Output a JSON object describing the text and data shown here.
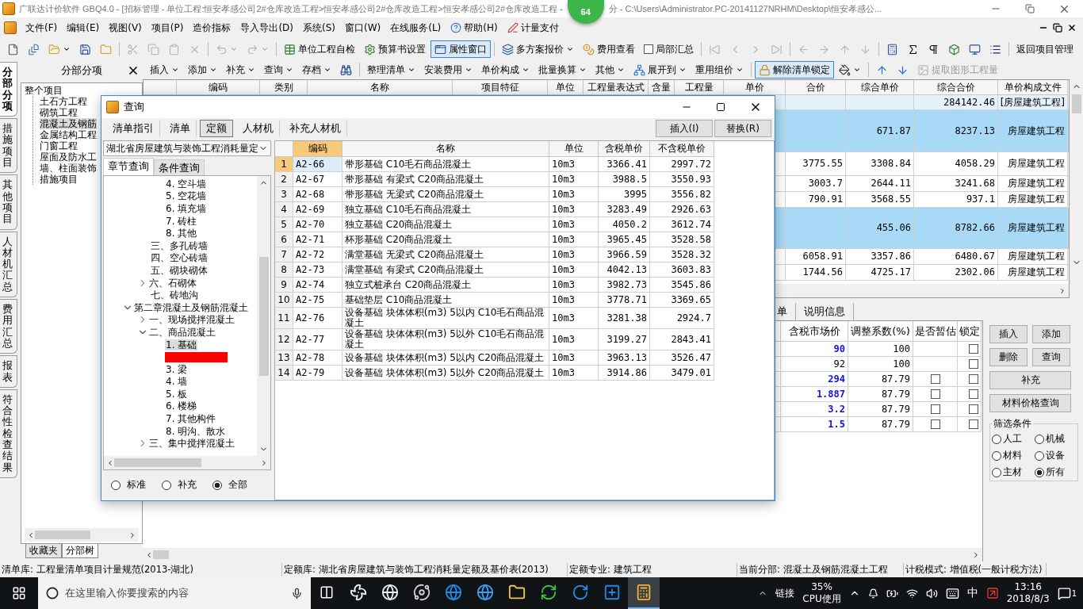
{
  "title": {
    "text_left": "广联达计价软件 GBQ4.0 - [招标管理 - 单位工程:恒安孝感公司2#仓库改造工程>恒安孝感公司2#仓库改造工程>恒安孝感公司2#仓库改造工程 -",
    "badge": "64",
    "text_right": "分 - C:\\Users\\Administrator.PC-20141127NRHM\\Desktop\\恒安孝感公..."
  },
  "menu": [
    "文件(F)",
    "编辑(E)",
    "视图(V)",
    "项目(P)",
    "造价指标",
    "导入导出(D)",
    "系统(S)",
    "窗口(W)",
    "在线服务(L)",
    "帮助(H)",
    "计量支付"
  ],
  "toolbar": [
    {
      "kind": "icon",
      "disabled": false
    },
    {
      "kind": "icon",
      "disabled": false
    },
    {
      "kind": "icon",
      "disabled": false,
      "dropdown": true
    },
    {
      "kind": "icon",
      "disabled": false
    },
    {
      "kind": "icon",
      "disabled": false
    },
    {
      "kind": "sep"
    },
    {
      "kind": "icon",
      "disabled": true
    },
    {
      "kind": "icon",
      "disabled": true
    },
    {
      "kind": "icon",
      "disabled": true
    },
    {
      "kind": "icon",
      "disabled": true
    },
    {
      "kind": "sep"
    },
    {
      "kind": "icon",
      "disabled": true,
      "dropdown": true
    },
    {
      "kind": "icon",
      "disabled": true,
      "dropdown": true
    },
    {
      "kind": "sep"
    },
    {
      "kind": "button",
      "label": "单位工程自检",
      "pressed": false
    },
    {
      "kind": "button",
      "label": "预算书设置",
      "pressed": false
    },
    {
      "kind": "button",
      "label": "属性窗口",
      "pressed": true
    },
    {
      "kind": "sep"
    },
    {
      "kind": "button",
      "label": "多方案报价",
      "pressed": false,
      "dropdown": true
    },
    {
      "kind": "button",
      "label": "费用查看",
      "pressed": false
    },
    {
      "kind": "check",
      "label": "局部汇总",
      "checked": false
    },
    {
      "kind": "sep"
    },
    {
      "kind": "icon",
      "disabled": true
    },
    {
      "kind": "icon",
      "disabled": true
    },
    {
      "kind": "icon",
      "disabled": true
    },
    {
      "kind": "icon",
      "disabled": true
    },
    {
      "kind": "sep"
    },
    {
      "kind": "icon",
      "disabled": true
    },
    {
      "kind": "icon",
      "disabled": true
    },
    {
      "kind": "icon",
      "disabled": true
    },
    {
      "kind": "icon",
      "disabled": true
    },
    {
      "kind": "sep"
    },
    {
      "kind": "icon",
      "disabled": false
    },
    {
      "kind": "icon",
      "disabled": false
    },
    {
      "kind": "icon",
      "disabled": false
    },
    {
      "kind": "icon",
      "disabled": false
    },
    {
      "kind": "icon",
      "disabled": false
    },
    {
      "kind": "icon",
      "disabled": false
    },
    {
      "kind": "sep"
    },
    {
      "kind": "button",
      "label": "返回项目管理",
      "pressed": false
    }
  ],
  "side_tabs": [
    {
      "label": "分部分项",
      "selected": true
    },
    {
      "label": "措施项目",
      "selected": false
    },
    {
      "label": "其他项目",
      "selected": false
    },
    {
      "label": "人材机汇总",
      "selected": false
    },
    {
      "label": "费用汇总",
      "selected": false
    },
    {
      "label": "报表",
      "selected": false
    },
    {
      "label": "符合性检查结果",
      "selected": false
    }
  ],
  "section_panel": {
    "title": "分部分项",
    "tree": {
      "label": "整个项目",
      "children": [
        {
          "label": "土石方工程",
          "selected": false
        },
        {
          "label": "砌筑工程",
          "selected": false
        },
        {
          "label": "混凝土及钢筋",
          "selected": true
        },
        {
          "label": "金属结构工程",
          "selected": false
        },
        {
          "label": "门窗工程",
          "selected": false
        },
        {
          "label": "屋面及防水工",
          "selected": false
        },
        {
          "label": "墙、柱面装饰",
          "selected": false
        },
        {
          "label": "措施项目",
          "selected": false
        }
      ]
    },
    "bottom_tabs": [
      {
        "label": "收藏夹",
        "selected": false
      },
      {
        "label": "分部树",
        "selected": true
      }
    ]
  },
  "edit_toolbar": [
    {
      "kind": "button",
      "label": "插入",
      "dropdown": true
    },
    {
      "kind": "button",
      "label": "添加",
      "dropdown": true
    },
    {
      "kind": "button",
      "label": "补充",
      "dropdown": true
    },
    {
      "kind": "button",
      "label": "查询",
      "dropdown": true
    },
    {
      "kind": "button",
      "label": "存档",
      "dropdown": true
    },
    {
      "kind": "icon"
    },
    {
      "kind": "sep"
    },
    {
      "kind": "button",
      "label": "整理清单",
      "dropdown": true
    },
    {
      "kind": "button",
      "label": "安装费用",
      "dropdown": true
    },
    {
      "kind": "button",
      "label": "单价构成",
      "dropdown": true
    },
    {
      "kind": "button",
      "label": "批量换算",
      "dropdown": true
    },
    {
      "kind": "button",
      "label": "其他",
      "dropdown": true
    },
    {
      "kind": "button",
      "label": "展开到",
      "dropdown": true
    },
    {
      "kind": "button",
      "label": "重用组价",
      "dropdown": true
    },
    {
      "kind": "sep"
    },
    {
      "kind": "button",
      "label": "解除清单锁定",
      "pressed": true
    },
    {
      "kind": "icon",
      "dropdown": true
    },
    {
      "kind": "sep"
    },
    {
      "kind": "icon"
    },
    {
      "kind": "icon"
    },
    {
      "kind": "button",
      "label": "提取图形工程量",
      "disabled": true
    }
  ],
  "main_table": {
    "columns": [
      "编码",
      "类别",
      "名称",
      "项目特征",
      "单位",
      "工程量表达式",
      "含量",
      "工程量",
      "单价",
      "合价",
      "综合单价",
      "综合合价",
      "单价构成文件"
    ],
    "rows": [
      {
        "kind": "project",
        "composite_total": "284142.46",
        "pricing_file": "[房屋建筑工程]"
      },
      {
        "kind": "section",
        "composite_unit_price": "671.87",
        "composite_total": "8237.13",
        "pricing_file": "房屋建筑工程"
      },
      {
        "kind": "item",
        "total_price": "3775.55",
        "composite_unit_price": "3308.84",
        "composite_total": "4058.29",
        "pricing_file": "房屋建筑工程"
      },
      {
        "kind": "item",
        "total_price": "3003.7",
        "composite_unit_price": "2644.11",
        "composite_total": "3241.68",
        "pricing_file": "房屋建筑工程"
      },
      {
        "kind": "item",
        "total_price": "790.91",
        "composite_unit_price": "3568.55",
        "composite_total": "937.1",
        "pricing_file": "房屋建筑工程"
      },
      {
        "kind": "section",
        "composite_unit_price": "455.06",
        "composite_total": "8782.66",
        "pricing_file": "房屋建筑工程"
      },
      {
        "kind": "item",
        "total_price": "6058.91",
        "composite_unit_price": "3357.86",
        "composite_total": "6480.67",
        "pricing_file": "房屋建筑工程"
      },
      {
        "kind": "item",
        "total_price": "1744.56",
        "composite_unit_price": "4725.17",
        "composite_total": "2302.06",
        "pricing_file": "房屋建筑工程"
      }
    ]
  },
  "detail_tabs": [
    "单",
    "说明信息"
  ],
  "detail_table": {
    "columns": [
      "含税市场价",
      "调整系数(%)",
      "是否暂估",
      "锁定"
    ],
    "rows": [
      {
        "market_price": "90",
        "modified": true,
        "factor": "100",
        "locked": false
      },
      {
        "market_price": "92",
        "modified": false,
        "factor": "100",
        "locked": false
      },
      {
        "market_price": "294",
        "modified": true,
        "factor": "87.79",
        "estimated": false,
        "locked": false
      },
      {
        "market_price": "1.887",
        "modified": true,
        "factor": "87.79",
        "estimated": false,
        "locked": false
      },
      {
        "market_price": "3.2",
        "modified": true,
        "factor": "87.79",
        "estimated": false,
        "locked": false
      },
      {
        "market_price": "1.5",
        "modified": true,
        "factor": "87.79",
        "estimated": false,
        "locked": false
      }
    ]
  },
  "side_buttons": [
    "插入",
    "添加",
    "删除",
    "查询",
    "补充",
    "材料价格查询"
  ],
  "filter": {
    "title": "筛选条件",
    "options": [
      {
        "label": "人工",
        "selected": false
      },
      {
        "label": "机械",
        "selected": false
      },
      {
        "label": "材料",
        "selected": false
      },
      {
        "label": "设备",
        "selected": false
      },
      {
        "label": "主材",
        "selected": false
      },
      {
        "label": "所有",
        "selected": true
      }
    ]
  },
  "dialog": {
    "title": "查询",
    "tabs": [
      {
        "label": "清单指引",
        "selected": false
      },
      {
        "label": "清单",
        "selected": false
      },
      {
        "label": "定额",
        "selected": true
      },
      {
        "label": "人材机",
        "selected": false
      },
      {
        "label": "补充人材机",
        "selected": false
      }
    ],
    "buttons": [
      "插入(I)",
      "替换(R)"
    ],
    "library": "湖北省房屋建筑与装饰工程消耗量定",
    "sub_tabs": [
      {
        "label": "章节查询",
        "selected": true
      },
      {
        "label": "条件查询",
        "selected": false
      }
    ],
    "tree": [
      {
        "children": [
          {
            "children": [
              {
                "children": [
                  {
                    "label": "4. 空斗墙"
                  },
                  {
                    "label": "5. 空花墙"
                  },
                  {
                    "label": "6. 填充墙"
                  },
                  {
                    "label": "7. 砖柱"
                  },
                  {
                    "label": "8. 其他"
                  }
                ]
              },
              {
                "label": "三、多孔砖墙"
              },
              {
                "label": "四、空心砖墙"
              },
              {
                "label": "五、砌块砌体"
              },
              {
                "label": "六、石砌体",
                "expanded": false
              },
              {
                "label": "七、砖地沟"
              }
            ]
          },
          {
            "label": "第二章混凝土及钢筋混凝土",
            "expanded": true,
            "children": [
              {
                "label": "一、现场搅拌混凝土",
                "expanded": false
              },
              {
                "label": "二、商品混凝土",
                "expanded": true,
                "children": [
                  {
                    "label": "1. 基础",
                    "selected": true
                  },
                  {
                    "kind": "redacted"
                  },
                  {
                    "label": "3. 梁"
                  },
                  {
                    "label": "4. 墙"
                  },
                  {
                    "label": "5. 板"
                  },
                  {
                    "label": "6. 楼梯"
                  },
                  {
                    "label": "7. 其他构件"
                  },
                  {
                    "label": "8. 明沟、散水"
                  }
                ]
              },
              {
                "label": "三、集中搅拌混凝土",
                "expanded": false
              }
            ]
          }
        ]
      }
    ],
    "scope": [
      {
        "label": "标准",
        "selected": false
      },
      {
        "label": "补充",
        "selected": false
      },
      {
        "label": "全部",
        "selected": true
      }
    ],
    "table": {
      "columns": [
        "编码",
        "名称",
        "单位",
        "含税单价",
        "不含税单价"
      ],
      "rows": [
        {
          "no": "1",
          "code": "A2-66",
          "name": "带形基础 C10毛石商品混凝土",
          "unit": "10m3",
          "price_tax": "3366.41",
          "price_net": "2997.72",
          "selected": true,
          "underlined": false
        },
        {
          "no": "2",
          "code": "A2-67",
          "name": "带形基础 有梁式 C20商品混凝土",
          "unit": "10m3",
          "price_tax": "3988.5",
          "price_net": "3550.93",
          "selected": false,
          "underlined": false
        },
        {
          "no": "3",
          "code": "A2-68",
          "name": "带形基础 无梁式 C20商品混凝土",
          "unit": "10m3",
          "price_tax": "3995",
          "price_net": "3556.82",
          "selected": false,
          "underlined": false
        },
        {
          "no": "4",
          "code": "A2-69",
          "name": "独立基础 C10毛石商品混凝土",
          "unit": "10m3",
          "price_tax": "3283.49",
          "price_net": "2926.63",
          "selected": false,
          "underlined": false
        },
        {
          "no": "5",
          "code": "A2-70",
          "name": "独立基础 C20商品混凝土",
          "unit": "10m3",
          "price_tax": "4050.2",
          "price_net": "3612.74",
          "selected": false,
          "underlined": false
        },
        {
          "no": "6",
          "code": "A2-71",
          "name": "杯形基础 C20商品混凝土",
          "unit": "10m3",
          "price_tax": "3965.45",
          "price_net": "3528.58",
          "selected": false,
          "underlined": false
        },
        {
          "no": "7",
          "code": "A2-72",
          "name": "满堂基础 无梁式 C20商品混凝土",
          "unit": "10m3",
          "price_tax": "3966.59",
          "price_net": "3528.32",
          "selected": false,
          "underlined": false
        },
        {
          "no": "8",
          "code": "A2-73",
          "name": "满堂基础 有梁式 C20商品混凝土",
          "unit": "10m3",
          "price_tax": "4042.13",
          "price_net": "3603.83",
          "selected": false,
          "underlined": true
        },
        {
          "no": "9",
          "code": "A2-74",
          "name": "独立式桩承台 C20商品混凝土",
          "unit": "10m3",
          "price_tax": "3982.73",
          "price_net": "3545.86",
          "selected": false,
          "underlined": false
        },
        {
          "no": "10",
          "code": "A2-75",
          "name": "基础垫层 C10商品混凝土",
          "unit": "10m3",
          "price_tax": "3778.71",
          "price_net": "3369.65",
          "selected": false,
          "underlined": false
        },
        {
          "no": "11",
          "code": "A2-76",
          "name": "设备基础 块体体积(m3) 5以内 C10毛石商品混凝土",
          "unit": "10m3",
          "price_tax": "3281.38",
          "price_net": "2924.7",
          "selected": false,
          "underlined": false
        },
        {
          "no": "12",
          "code": "A2-77",
          "name": "设备基础 块体体积(m3) 5以外 C10毛石商品混凝土",
          "unit": "10m3",
          "price_tax": "3199.27",
          "price_net": "2843.41",
          "selected": false,
          "underlined": false
        },
        {
          "no": "13",
          "code": "A2-78",
          "name": "设备基础 块体体积(m3) 5以内 C20商品混凝土",
          "unit": "10m3",
          "price_tax": "3963.13",
          "price_net": "3526.47",
          "selected": false,
          "underlined": false
        },
        {
          "no": "14",
          "code": "A2-79",
          "name": "设备基础 块体体积(m3) 5以外 C20商品混凝土",
          "unit": "10m3",
          "price_tax": "3914.86",
          "price_net": "3479.01",
          "selected": false,
          "underlined": false
        }
      ]
    }
  },
  "status_bar": [
    "清单库: 工程量清单项目计量规范(2013-湖北)",
    "定额库: 湖北省房屋建筑与装饰工程消耗量定额及基价表(2013)",
    "定额专业: 建筑工程",
    "当前分部: 混凝土及钢筋混凝土工程",
    "计税模式: 增值税(一般计税方法)"
  ],
  "taskbar": {
    "search_placeholder": "在这里输入你要搜索的内容",
    "apps": [
      {
        "active": false
      },
      {
        "active": false
      },
      {
        "active": false
      },
      {
        "active": false
      },
      {
        "active": false
      },
      {
        "active": false
      },
      {
        "active": false
      },
      {
        "active": false
      },
      {
        "active": false
      },
      {
        "active": true
      }
    ],
    "link": "链接",
    "cpu_value": "35%",
    "cpu_label": "CPU使用",
    "ime": "中",
    "time": "13:16",
    "date": "2018/8/3",
    "notifications": "1"
  }
}
